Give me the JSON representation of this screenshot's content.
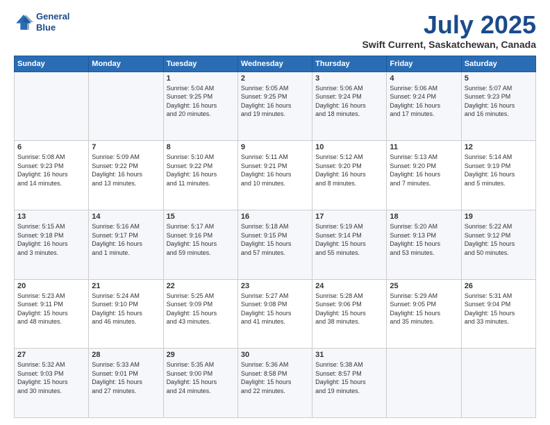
{
  "header": {
    "logo_line1": "General",
    "logo_line2": "Blue",
    "title": "July 2025",
    "subtitle": "Swift Current, Saskatchewan, Canada"
  },
  "days_of_week": [
    "Sunday",
    "Monday",
    "Tuesday",
    "Wednesday",
    "Thursday",
    "Friday",
    "Saturday"
  ],
  "weeks": [
    [
      {
        "day": "",
        "info": ""
      },
      {
        "day": "",
        "info": ""
      },
      {
        "day": "1",
        "info": "Sunrise: 5:04 AM\nSunset: 9:25 PM\nDaylight: 16 hours\nand 20 minutes."
      },
      {
        "day": "2",
        "info": "Sunrise: 5:05 AM\nSunset: 9:25 PM\nDaylight: 16 hours\nand 19 minutes."
      },
      {
        "day": "3",
        "info": "Sunrise: 5:06 AM\nSunset: 9:24 PM\nDaylight: 16 hours\nand 18 minutes."
      },
      {
        "day": "4",
        "info": "Sunrise: 5:06 AM\nSunset: 9:24 PM\nDaylight: 16 hours\nand 17 minutes."
      },
      {
        "day": "5",
        "info": "Sunrise: 5:07 AM\nSunset: 9:23 PM\nDaylight: 16 hours\nand 16 minutes."
      }
    ],
    [
      {
        "day": "6",
        "info": "Sunrise: 5:08 AM\nSunset: 9:23 PM\nDaylight: 16 hours\nand 14 minutes."
      },
      {
        "day": "7",
        "info": "Sunrise: 5:09 AM\nSunset: 9:22 PM\nDaylight: 16 hours\nand 13 minutes."
      },
      {
        "day": "8",
        "info": "Sunrise: 5:10 AM\nSunset: 9:22 PM\nDaylight: 16 hours\nand 11 minutes."
      },
      {
        "day": "9",
        "info": "Sunrise: 5:11 AM\nSunset: 9:21 PM\nDaylight: 16 hours\nand 10 minutes."
      },
      {
        "day": "10",
        "info": "Sunrise: 5:12 AM\nSunset: 9:20 PM\nDaylight: 16 hours\nand 8 minutes."
      },
      {
        "day": "11",
        "info": "Sunrise: 5:13 AM\nSunset: 9:20 PM\nDaylight: 16 hours\nand 7 minutes."
      },
      {
        "day": "12",
        "info": "Sunrise: 5:14 AM\nSunset: 9:19 PM\nDaylight: 16 hours\nand 5 minutes."
      }
    ],
    [
      {
        "day": "13",
        "info": "Sunrise: 5:15 AM\nSunset: 9:18 PM\nDaylight: 16 hours\nand 3 minutes."
      },
      {
        "day": "14",
        "info": "Sunrise: 5:16 AM\nSunset: 9:17 PM\nDaylight: 16 hours\nand 1 minute."
      },
      {
        "day": "15",
        "info": "Sunrise: 5:17 AM\nSunset: 9:16 PM\nDaylight: 15 hours\nand 59 minutes."
      },
      {
        "day": "16",
        "info": "Sunrise: 5:18 AM\nSunset: 9:15 PM\nDaylight: 15 hours\nand 57 minutes."
      },
      {
        "day": "17",
        "info": "Sunrise: 5:19 AM\nSunset: 9:14 PM\nDaylight: 15 hours\nand 55 minutes."
      },
      {
        "day": "18",
        "info": "Sunrise: 5:20 AM\nSunset: 9:13 PM\nDaylight: 15 hours\nand 53 minutes."
      },
      {
        "day": "19",
        "info": "Sunrise: 5:22 AM\nSunset: 9:12 PM\nDaylight: 15 hours\nand 50 minutes."
      }
    ],
    [
      {
        "day": "20",
        "info": "Sunrise: 5:23 AM\nSunset: 9:11 PM\nDaylight: 15 hours\nand 48 minutes."
      },
      {
        "day": "21",
        "info": "Sunrise: 5:24 AM\nSunset: 9:10 PM\nDaylight: 15 hours\nand 46 minutes."
      },
      {
        "day": "22",
        "info": "Sunrise: 5:25 AM\nSunset: 9:09 PM\nDaylight: 15 hours\nand 43 minutes."
      },
      {
        "day": "23",
        "info": "Sunrise: 5:27 AM\nSunset: 9:08 PM\nDaylight: 15 hours\nand 41 minutes."
      },
      {
        "day": "24",
        "info": "Sunrise: 5:28 AM\nSunset: 9:06 PM\nDaylight: 15 hours\nand 38 minutes."
      },
      {
        "day": "25",
        "info": "Sunrise: 5:29 AM\nSunset: 9:05 PM\nDaylight: 15 hours\nand 35 minutes."
      },
      {
        "day": "26",
        "info": "Sunrise: 5:31 AM\nSunset: 9:04 PM\nDaylight: 15 hours\nand 33 minutes."
      }
    ],
    [
      {
        "day": "27",
        "info": "Sunrise: 5:32 AM\nSunset: 9:03 PM\nDaylight: 15 hours\nand 30 minutes."
      },
      {
        "day": "28",
        "info": "Sunrise: 5:33 AM\nSunset: 9:01 PM\nDaylight: 15 hours\nand 27 minutes."
      },
      {
        "day": "29",
        "info": "Sunrise: 5:35 AM\nSunset: 9:00 PM\nDaylight: 15 hours\nand 24 minutes."
      },
      {
        "day": "30",
        "info": "Sunrise: 5:36 AM\nSunset: 8:58 PM\nDaylight: 15 hours\nand 22 minutes."
      },
      {
        "day": "31",
        "info": "Sunrise: 5:38 AM\nSunset: 8:57 PM\nDaylight: 15 hours\nand 19 minutes."
      },
      {
        "day": "",
        "info": ""
      },
      {
        "day": "",
        "info": ""
      }
    ]
  ]
}
